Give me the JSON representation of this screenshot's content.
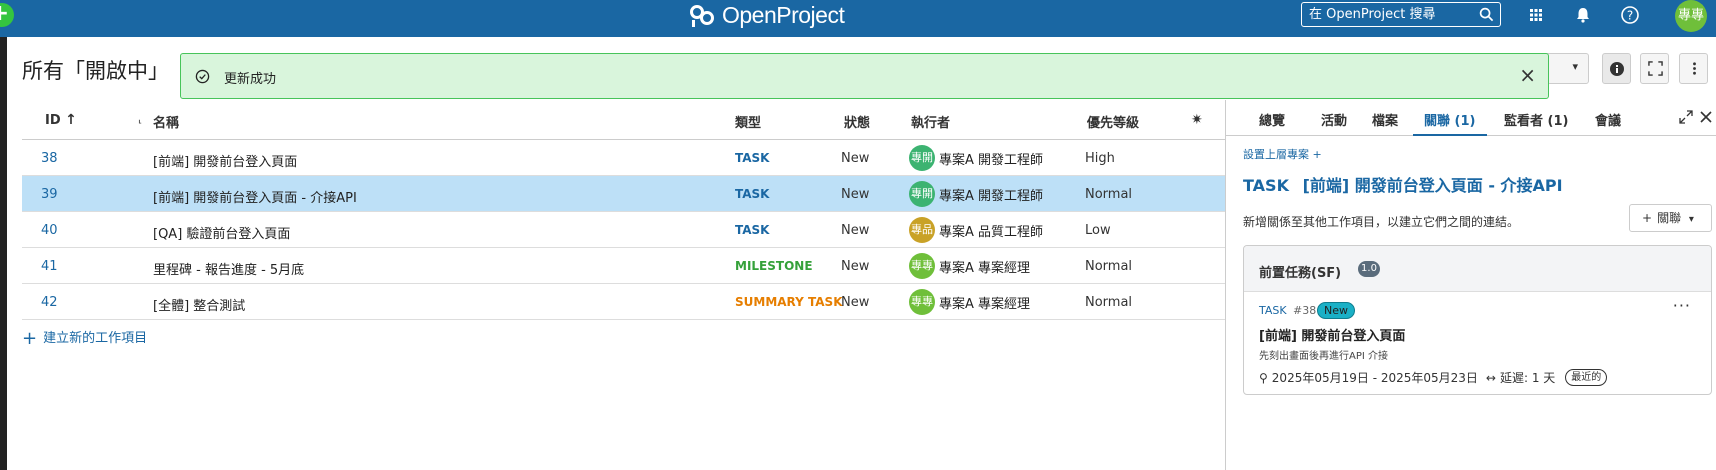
{
  "app": {
    "logo_text": "OpenProject",
    "search_placeholder": "在 OpenProject 搜尋",
    "user_avatar": "專專"
  },
  "page": {
    "title": "所有「開啟中」"
  },
  "toast": {
    "message": "更新成功"
  },
  "table": {
    "headers": {
      "id": "ID",
      "subject": "名稱",
      "type": "類型",
      "status": "狀態",
      "assignee": "執行者",
      "priority": "優先等級"
    },
    "rows": [
      {
        "id": "38",
        "subject": "[前端] 開發前台登入頁面",
        "type": "TASK",
        "type_color": "#1a67a3",
        "status": "New",
        "avatar": "專開",
        "avatar_color": "#3cb371",
        "assignee": "專案A 開發工程師",
        "priority": "High"
      },
      {
        "id": "39",
        "subject": "[前端] 開發前台登入頁面 - 介接API",
        "type": "TASK",
        "type_color": "#1a67a3",
        "status": "New",
        "avatar": "專開",
        "avatar_color": "#3cb371",
        "assignee": "專案A 開發工程師",
        "priority": "Normal"
      },
      {
        "id": "40",
        "subject": "[QA] 驗證前台登入頁面",
        "type": "TASK",
        "type_color": "#1a67a3",
        "status": "New",
        "avatar": "專品",
        "avatar_color": "#c9a227",
        "assignee": "專案A 品質工程師",
        "priority": "Low"
      },
      {
        "id": "41",
        "subject": "里程碑 - 報告進度 - 5月底",
        "type": "MILESTONE",
        "type_color": "#35a13a",
        "status": "New",
        "avatar": "專專",
        "avatar_color": "#6fbf3a",
        "assignee": "專案A 專案經理",
        "priority": "Normal"
      },
      {
        "id": "42",
        "subject": "[全體] 整合測試",
        "type": "SUMMARY TASK",
        "type_color": "#e67e00",
        "status": "New",
        "avatar": "專專",
        "avatar_color": "#6fbf3a",
        "assignee": "專案A 專案經理",
        "priority": "Normal"
      }
    ],
    "selected_index": 1,
    "create_label": "建立新的工作項目"
  },
  "split": {
    "tabs": [
      "總覽",
      "活動",
      "檔案",
      "關聯 (1)",
      "監看者 (1)",
      "會議"
    ],
    "active_tab": 3,
    "parent_link": "設置上層專案 +",
    "wp_type": "TASK",
    "wp_subject": "[前端] 開發前台登入頁面 - 介接API",
    "relations_hint": "新增關係至其他工作項目，以建立它們之間的連結。",
    "relations_button": "關聯",
    "group": {
      "title": "前置任務(SF)",
      "count": "1.0",
      "item": {
        "type": "TASK",
        "id": "#38",
        "status": "New",
        "subject": "[前端] 開發前台登入頁面",
        "description": "先刻出畫面後再進行API 介接",
        "dates": "2025年05月19日 - 2025年05月23日",
        "delay": "延遲: 1 天",
        "recent": "最近的"
      }
    }
  }
}
